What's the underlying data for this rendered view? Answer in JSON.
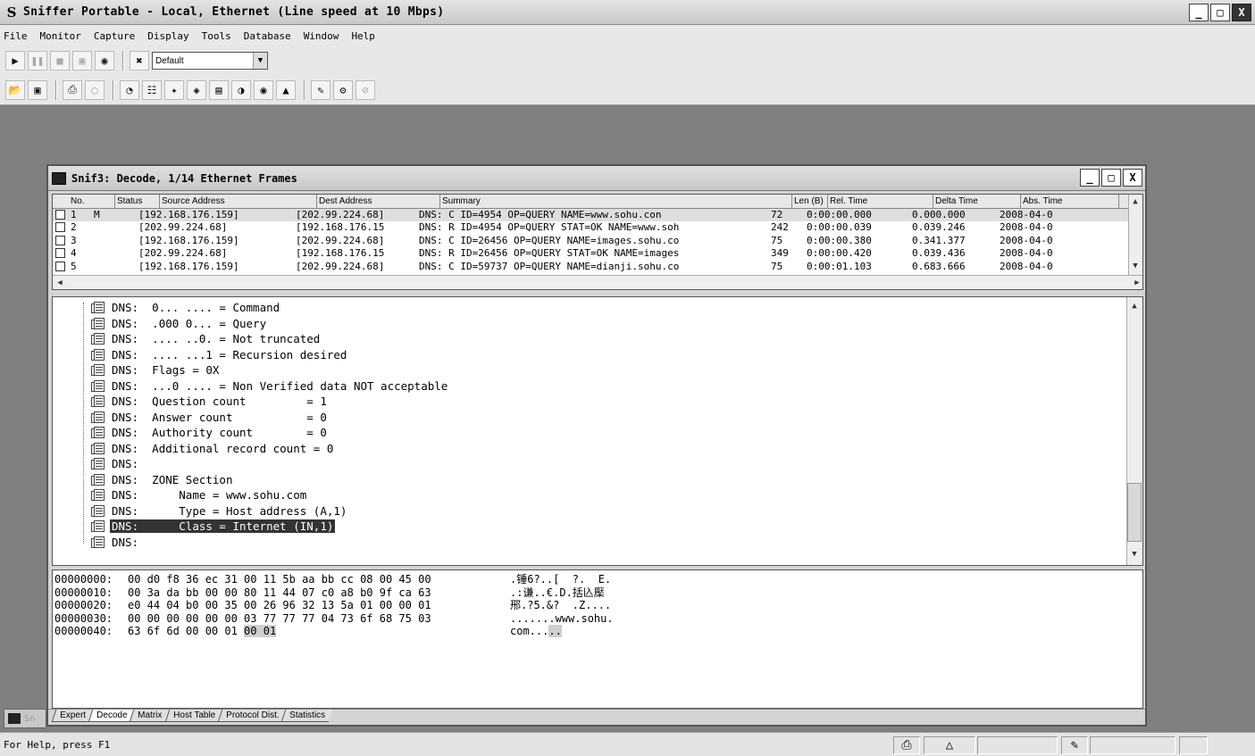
{
  "app": {
    "title": "Sniffer Portable - Local, Ethernet (Line speed at 10 Mbps)",
    "logo": "S",
    "window_buttons": [
      "_",
      "□",
      "X"
    ]
  },
  "menu": [
    "File",
    "Monitor",
    "Capture",
    "Display",
    "Tools",
    "Database",
    "Window",
    "Help"
  ],
  "toolbar1": {
    "icons": [
      "play-icon",
      "pause-icon",
      "stop-icon",
      "stop-and-display-icon",
      "binoculars-icon",
      "capture-filter-icon"
    ],
    "profile_value": "Default"
  },
  "toolbar2": {
    "icons": [
      "open-icon",
      "save-icon",
      "print-icon",
      "print-preview-icon",
      "dashboard-icon",
      "host-table-icon",
      "matrix-icon",
      "application-response-icon",
      "history-icon",
      "protocol-dist-icon",
      "global-stats-icon",
      "alarm-log-icon",
      "expert-icon",
      "packet-gen-icon",
      "stop-gen-icon"
    ]
  },
  "decode_window": {
    "title": "Snif3: Decode, 1/14 Ethernet Frames",
    "columns": [
      "No.",
      "Status",
      "Source Address",
      "Dest Address",
      "Summary",
      "Len (B)",
      "Rel. Time",
      "Delta Time",
      "Abs. Time"
    ],
    "packets": [
      {
        "no": "1",
        "status": "M",
        "src": "[192.168.176.159]",
        "dst": "[202.99.224.68]",
        "summary": "DNS: C ID=4954 OP=QUERY NAME=www.sohu.con",
        "len": "72",
        "rel": "0:00:00.000",
        "delta": "0.000.000",
        "abs": "2008-04-0"
      },
      {
        "no": "2",
        "status": "",
        "src": "[202.99.224.68]",
        "dst": "[192.168.176.15",
        "summary": "DNS: R ID=4954 OP=QUERY STAT=OK NAME=www.soh",
        "len": "242",
        "rel": "0:00:00.039",
        "delta": "0.039.246",
        "abs": "2008-04-0"
      },
      {
        "no": "3",
        "status": "",
        "src": "[192.168.176.159]",
        "dst": "[202.99.224.68]",
        "summary": "DNS: C ID=26456 OP=QUERY NAME=images.sohu.co",
        "len": "75",
        "rel": "0:00:00.380",
        "delta": "0.341.377",
        "abs": "2008-04-0"
      },
      {
        "no": "4",
        "status": "",
        "src": "[202.99.224.68]",
        "dst": "[192.168.176.15",
        "summary": "DNS: R ID=26456 OP=QUERY STAT=OK NAME=images",
        "len": "349",
        "rel": "0:00:00.420",
        "delta": "0.039.436",
        "abs": "2008-04-0"
      },
      {
        "no": "5",
        "status": "",
        "src": "[192.168.176.159]",
        "dst": "[202.99.224.68]",
        "summary": "DNS: C ID=59737 OP=QUERY NAME=dianji.sohu.co",
        "len": "75",
        "rel": "0:00:01.103",
        "delta": "0.683.666",
        "abs": "2008-04-0"
      }
    ],
    "decode_lines": [
      {
        "label": "DNS:",
        "text": "0... .... = Command"
      },
      {
        "label": "DNS:",
        "text": ".000 0... = Query"
      },
      {
        "label": "DNS:",
        "text": ".... ..0. = Not truncated"
      },
      {
        "label": "DNS:",
        "text": ".... ...1 = Recursion desired"
      },
      {
        "label": "DNS:",
        "text": "Flags = 0X"
      },
      {
        "label": "DNS:",
        "text": "...0 .... = Non Verified data NOT acceptable"
      },
      {
        "label": "DNS:",
        "text": "Question count         = 1"
      },
      {
        "label": "DNS:",
        "text": "Answer count           = 0"
      },
      {
        "label": "DNS:",
        "text": "Authority count        = 0"
      },
      {
        "label": "DNS:",
        "text": "Additional record count = 0"
      },
      {
        "label": "DNS:",
        "text": ""
      },
      {
        "label": "DNS:",
        "text": "ZONE Section"
      },
      {
        "label": "DNS:",
        "text": "    Name = www.sohu.com"
      },
      {
        "label": "DNS:",
        "text": "    Type = Host address (A,1)"
      },
      {
        "label": "DNS:",
        "text": "    Class = Internet (IN,1)"
      },
      {
        "label": "DNS:",
        "text": ""
      }
    ],
    "hex_lines": [
      {
        "offset": "00000000:",
        "bytes": "00 d0 f8 36 ec 31 00 11 5b aa bb cc 08 00 45 00",
        "ascii": ".锤6?..[  ?.  E."
      },
      {
        "offset": "00000010:",
        "bytes": "00 3a da bb 00 00 80 11 44 07 c0 a8 b0 9f ca 63",
        "ascii": ".:谦..€.D.括兦檿"
      },
      {
        "offset": "00000020:",
        "bytes": "e0 44 04 b0 00 35 00 26 96 32 13 5a 01 00 00 01",
        "ascii": "郉.?5.&?  .Z...."
      },
      {
        "offset": "00000030:",
        "bytes": "00 00 00 00 00 00 03 77 77 77 04 73 6f 68 75 03",
        "ascii": ".......www.sohu."
      },
      {
        "offset": "00000040:",
        "bytes": "63 6f 6d 00 00 01 ",
        "bytes_sel": "00 01",
        "ascii": "com...",
        "ascii_sel": ".."
      }
    ],
    "tabs": [
      "Expert",
      "Decode",
      "Matrix",
      "Host Table",
      "Protocol Dist.",
      "Statistics"
    ],
    "active_tab": "Decode"
  },
  "minimized": {
    "label": "Sn"
  },
  "status_bar": {
    "help": "For Help, press F1"
  }
}
